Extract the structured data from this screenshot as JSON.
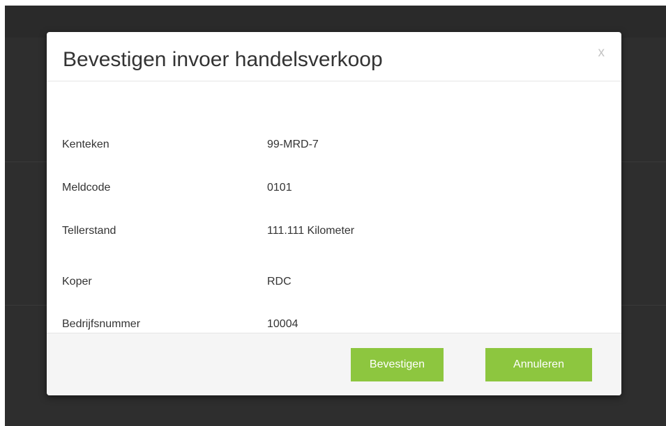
{
  "dialog": {
    "title": "Bevestigen invoer handelsverkoop",
    "close_label": "x"
  },
  "details": [
    {
      "label": "Kenteken",
      "value": "99-MRD-7"
    },
    {
      "label": "Meldcode",
      "value": "0101"
    },
    {
      "label": "Tellerstand",
      "value": "111.111 Kilometer"
    },
    {
      "label": "Koper",
      "value": "RDC"
    },
    {
      "label": "Bedrijfsnummer",
      "value": "10004"
    }
  ],
  "footer": {
    "confirm_label": "Bevestigen",
    "cancel_label": "Annuleren"
  },
  "colors": {
    "button_green": "#8dc63f",
    "backdrop": "#2e2e2e"
  }
}
